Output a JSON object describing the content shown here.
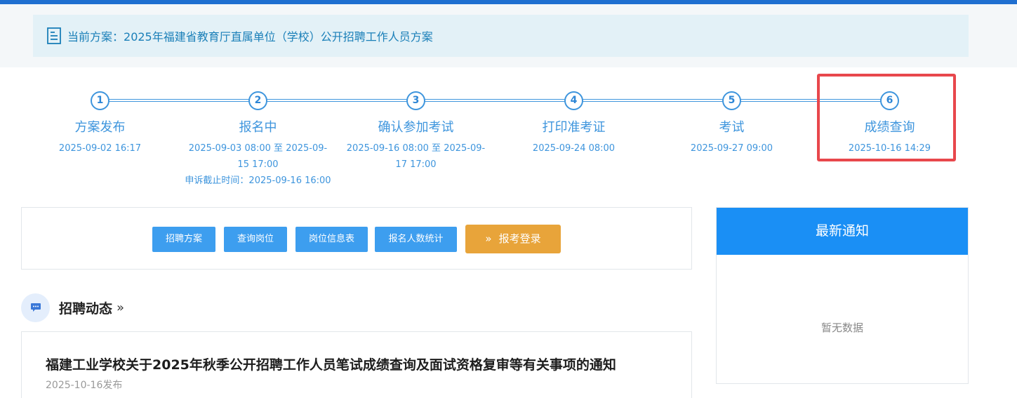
{
  "plan": {
    "label": "当前方案：",
    "title": "2025年福建省教育厅直属单位（学校）公开招聘工作人员方案"
  },
  "steps": [
    {
      "number": "1",
      "name": "方案发布",
      "date": "2025-09-02 16:17"
    },
    {
      "number": "2",
      "name": "报名中",
      "date": "2025-09-03 08:00 至 2025-09-15 17:00",
      "extra": "申诉截止时间：2025-09-16 16:00"
    },
    {
      "number": "3",
      "name": "确认参加考试",
      "date": "2025-09-16 08:00 至 2025-09-17 17:00"
    },
    {
      "number": "4",
      "name": "打印准考证",
      "date": "2025-09-24 08:00"
    },
    {
      "number": "5",
      "name": "考试",
      "date": "2025-09-27 09:00"
    },
    {
      "number": "6",
      "name": "成绩查询",
      "date": "2025-10-16 14:29"
    }
  ],
  "buttons": {
    "plan": "招聘方案",
    "query_post": "查询岗位",
    "post_table": "岗位信息表",
    "stats": "报名人数统计",
    "login": "报考登录",
    "login_icon": "»"
  },
  "news": {
    "section_title": "招聘动态",
    "section_chevron": "»",
    "item_title": "福建工业学校关于2025年秋季公开招聘工作人员笔试成绩查询及面试资格复审等有关事项的通知",
    "item_date": "2025-10-16发布"
  },
  "notice": {
    "title": "最新通知",
    "empty": "暂无数据"
  },
  "colors": {
    "accent": "#3e95dd",
    "header_bar": "#1f6fd0",
    "highlight": "#e8474c",
    "login_button": "#e8a43a",
    "notice_head": "#1a8ff5"
  }
}
